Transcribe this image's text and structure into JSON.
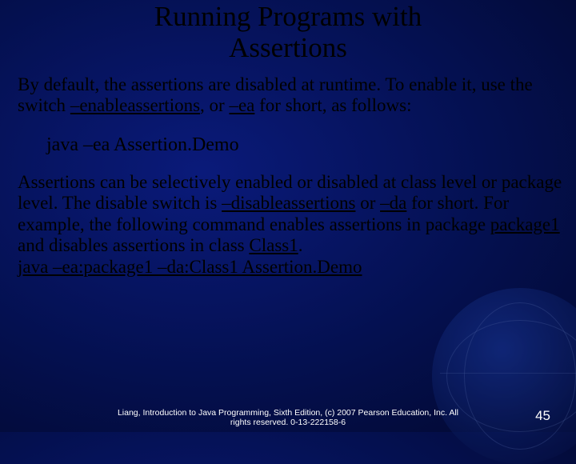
{
  "title_line1": "Running Programs with",
  "title_line2": "Assertions",
  "p1_a": "By default, the assertions are disabled at runtime. To enable it, use the switch ",
  "p1_flag_long": "–enableassertions",
  "p1_b": ", or ",
  "p1_flag_short": "–ea",
  "p1_c": " for short, as follows:",
  "cmd1": "java –ea Assertion.Demo",
  "p2_a": "Assertions can be selectively enabled or disabled at class level or package level. The disable switch is ",
  "p2_flag_long": "–disableassertions",
  "p2_b": " or ",
  "p2_flag_short": "–da",
  "p2_c": " for short. For example, the following command enables assertions in package ",
  "pkg": "package1",
  "p2_d": " and disables assertions in class ",
  "cls": "Class1",
  "p2_e": ".",
  "cmd2": "java –ea:package1 –da:Class1 Assertion.Demo",
  "footer1": "Liang, Introduction to Java Programming, Sixth Edition, (c) 2007 Pearson Education, Inc. All",
  "footer2": "rights reserved. 0-13-222158-6",
  "page": "45"
}
